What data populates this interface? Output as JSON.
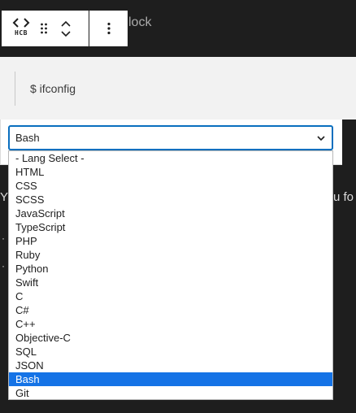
{
  "toolbar": {
    "block_icon_label": "HCB",
    "block_title_peek": "lock"
  },
  "code_block": {
    "code": "$ ifconfig"
  },
  "language_select": {
    "selected": "Bash",
    "options": [
      "- Lang Select -",
      "HTML",
      "CSS",
      "SCSS",
      "JavaScript",
      "TypeScript",
      "PHP",
      "Ruby",
      "Python",
      "Swift",
      "C",
      "C#",
      "C++",
      "Objective-C",
      "SQL",
      "JSON",
      "Bash",
      "Git"
    ],
    "highlighted_index": 16
  },
  "background": {
    "left_fragment": "Y",
    "right_fragment": "u fo",
    "bullet_1": "·",
    "bullet_2": "·"
  },
  "colors": {
    "editor_bg": "#1e1e1e",
    "code_bg": "#f2f2f2",
    "focus_border": "#0a6fbf",
    "highlight": "#1573e6"
  }
}
